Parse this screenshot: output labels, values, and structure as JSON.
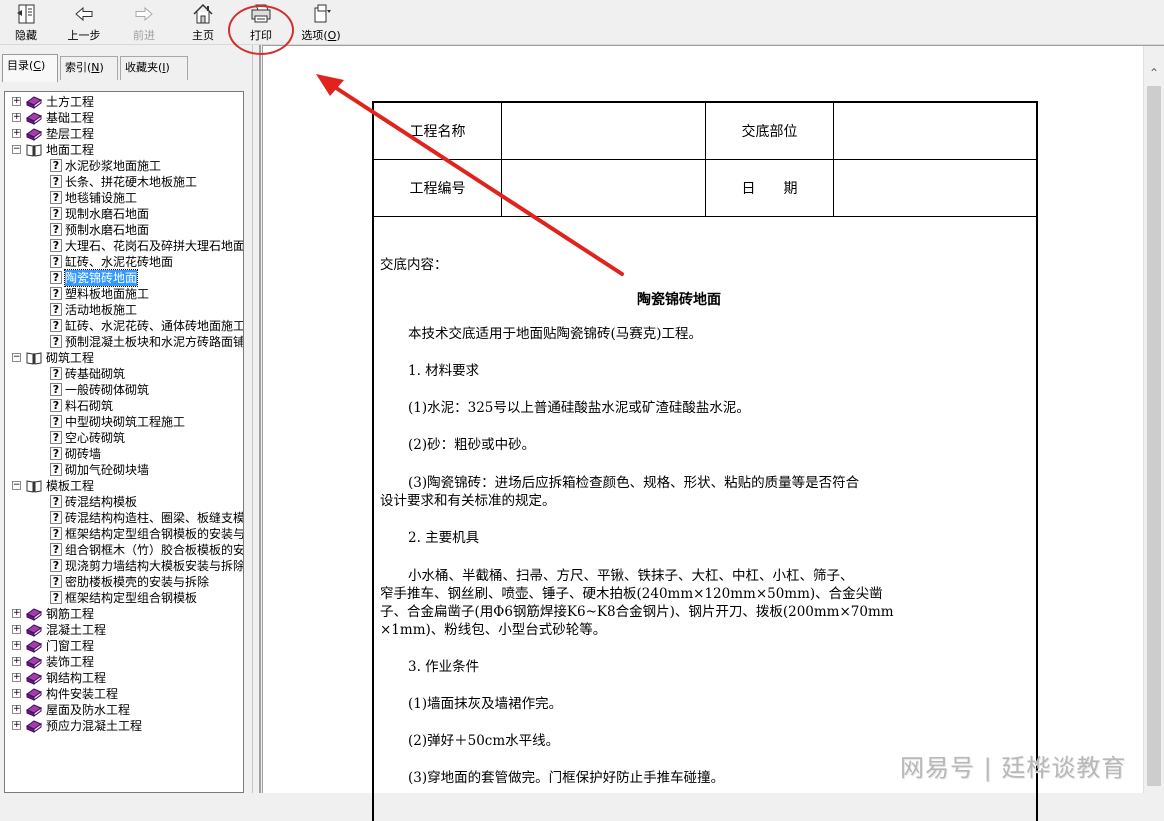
{
  "toolbar": {
    "items": [
      {
        "name": "hide",
        "label": "隐藏",
        "icon": "hide-pane-icon",
        "enabled": true
      },
      {
        "name": "back",
        "label": "上一步",
        "icon": "back-arrow-icon",
        "enabled": true
      },
      {
        "name": "forward",
        "label": "前进",
        "icon": "forward-arrow-icon",
        "enabled": false
      },
      {
        "name": "home",
        "label": "主页",
        "icon": "home-icon",
        "enabled": true
      },
      {
        "name": "print",
        "label": "打印",
        "icon": "printer-icon",
        "enabled": true
      },
      {
        "name": "options",
        "label": "选项",
        "accel": "O",
        "icon": "options-icon",
        "enabled": true
      }
    ]
  },
  "tabs": [
    {
      "label": "目录",
      "accel": "C",
      "active": true
    },
    {
      "label": "索引",
      "accel": "N",
      "active": false
    },
    {
      "label": "收藏夹",
      "accel": "I",
      "active": false
    }
  ],
  "tree": [
    {
      "label": "土方工程",
      "type": "book",
      "expanded": false,
      "level": 0
    },
    {
      "label": "基础工程",
      "type": "book",
      "expanded": false,
      "level": 0
    },
    {
      "label": "垫层工程",
      "type": "book",
      "expanded": false,
      "level": 0
    },
    {
      "label": "地面工程",
      "type": "book",
      "expanded": true,
      "level": 0
    },
    {
      "label": "水泥砂浆地面施工",
      "type": "page",
      "level": 1
    },
    {
      "label": "长条、拼花硬木地板施工",
      "type": "page",
      "level": 1
    },
    {
      "label": "地毯铺设施工",
      "type": "page",
      "level": 1
    },
    {
      "label": "现制水磨石地面",
      "type": "page",
      "level": 1
    },
    {
      "label": "预制水磨石地面",
      "type": "page",
      "level": 1
    },
    {
      "label": "大理石、花岗石及碎拼大理石地面",
      "type": "page",
      "level": 1
    },
    {
      "label": "缸砖、水泥花砖地面",
      "type": "page",
      "level": 1
    },
    {
      "label": "陶瓷锦砖地面",
      "type": "page",
      "level": 1,
      "selected": true
    },
    {
      "label": "塑料板地面施工",
      "type": "page",
      "level": 1
    },
    {
      "label": "活动地板施工",
      "type": "page",
      "level": 1
    },
    {
      "label": "缸砖、水泥花砖、通体砖地面施工",
      "type": "page",
      "level": 1
    },
    {
      "label": "预制混凝土板块和水泥方砖路面铺",
      "type": "page",
      "level": 1
    },
    {
      "label": "砌筑工程",
      "type": "book",
      "expanded": true,
      "level": 0
    },
    {
      "label": "砖基础砌筑",
      "type": "page",
      "level": 1
    },
    {
      "label": "一般砖砌体砌筑",
      "type": "page",
      "level": 1
    },
    {
      "label": "料石砌筑",
      "type": "page",
      "level": 1
    },
    {
      "label": "中型砌块砌筑工程施工",
      "type": "page",
      "level": 1
    },
    {
      "label": "空心砖砌筑",
      "type": "page",
      "level": 1
    },
    {
      "label": "砌砖墙",
      "type": "page",
      "level": 1
    },
    {
      "label": "砌加气砼砌块墙",
      "type": "page",
      "level": 1
    },
    {
      "label": "模板工程",
      "type": "book",
      "expanded": true,
      "level": 0
    },
    {
      "label": "砖混结构模板",
      "type": "page",
      "level": 1
    },
    {
      "label": "砖混结构构造柱、圈梁、板缝支模",
      "type": "page",
      "level": 1
    },
    {
      "label": "框架结构定型组合钢模板的安装与",
      "type": "page",
      "level": 1
    },
    {
      "label": "组合钢框木（竹）胶合板模板的安",
      "type": "page",
      "level": 1
    },
    {
      "label": "现浇剪力墙结构大模板安装与拆除",
      "type": "page",
      "level": 1
    },
    {
      "label": "密肋楼板模壳的安装与拆除",
      "type": "page",
      "level": 1
    },
    {
      "label": "框架结构定型组合钢模板",
      "type": "page",
      "level": 1
    },
    {
      "label": "钢筋工程",
      "type": "book",
      "expanded": false,
      "level": 0
    },
    {
      "label": "混凝土工程",
      "type": "book",
      "expanded": false,
      "level": 0
    },
    {
      "label": "门窗工程",
      "type": "book",
      "expanded": false,
      "level": 0
    },
    {
      "label": "装饰工程",
      "type": "book",
      "expanded": false,
      "level": 0
    },
    {
      "label": "钢结构工程",
      "type": "book",
      "expanded": false,
      "level": 0
    },
    {
      "label": "构件安装工程",
      "type": "book",
      "expanded": false,
      "level": 0
    },
    {
      "label": "屋面及防水工程",
      "type": "book",
      "expanded": false,
      "level": 0
    },
    {
      "label": "预应力混凝土工程",
      "type": "book",
      "expanded": false,
      "level": 0
    }
  ],
  "document": {
    "header": {
      "project_name_label": "工程名称",
      "project_name_value": "",
      "location_label": "交底部位",
      "location_value": "",
      "project_no_label": "工程编号",
      "project_no_value": "",
      "date_label": "日　　期",
      "date_value": ""
    },
    "content_label": "交底内容：",
    "title": "陶瓷锦砖地面",
    "paragraphs": [
      "本技术交底适用于地面贴陶瓷锦砖(马赛克)工程。",
      "1. 材料要求",
      "(1)水泥：325号以上普通硅酸盐水泥或矿渣硅酸盐水泥。",
      "(2)砂：粗砂或中砂。",
      "(3)陶瓷锦砖：进场后应拆箱检查颜色、规格、形状、粘贴的质量等是否符合",
      "设计要求和有关标准的规定。",
      "2. 主要机具",
      "小水桶、半截桶、扫帚、方尺、平锹、铁抹子、大杠、中杠、小杠、筛子、",
      "窄手推车、钢丝刷、喷壶、锤子、硬木拍板(240mm×120mm×50mm)、合金尖凿",
      "子、合金扁凿子(用Φ6钢筋焊接K6~K8合金钢片)、钢片开刀、拨板(200mm×70mm",
      "×1mm)、粉线包、小型台式砂轮等。",
      "3. 作业条件",
      "(1)墙面抹灰及墙裙作完。",
      "(2)弹好＋50cm水平线。",
      "(3)穿地面的套管做完。门框保护好防止手推车碰撞。"
    ]
  },
  "watermark": "网易号 | 廷桦谈教育",
  "annotation": {
    "color": "#e0231c",
    "circle_target": "打印"
  }
}
